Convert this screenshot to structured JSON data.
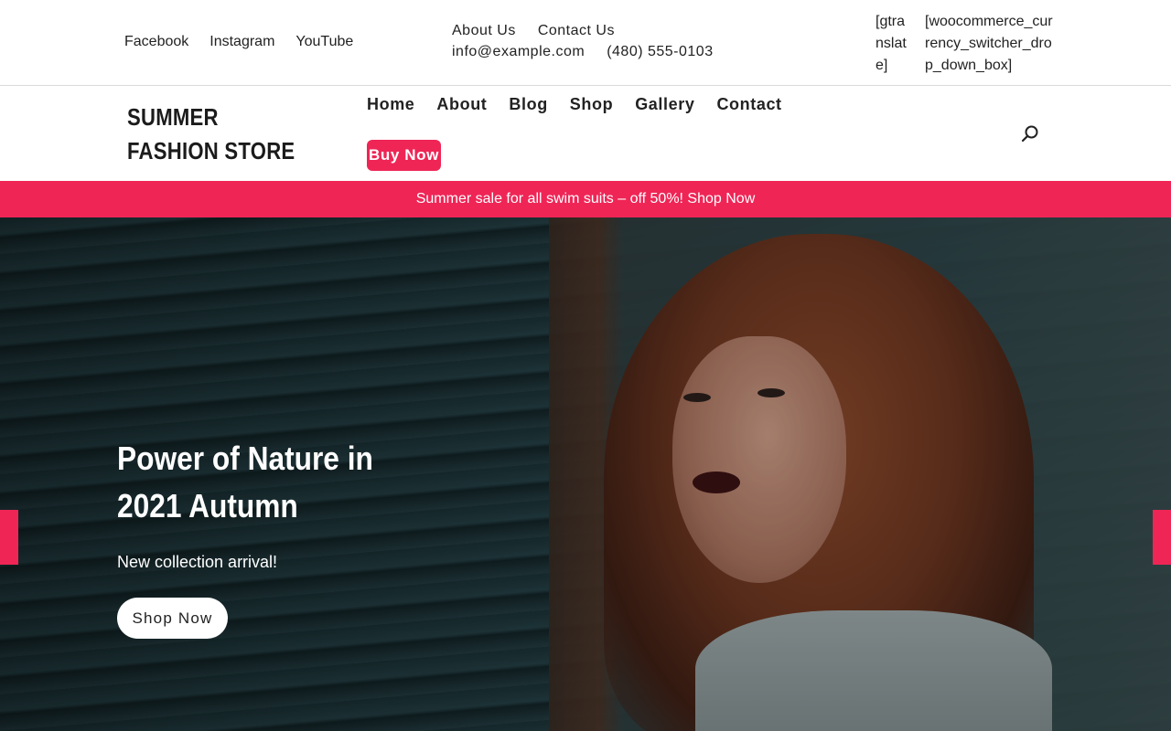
{
  "topbar": {
    "social": [
      "Facebook",
      "Instagram",
      "YouTube"
    ],
    "links": [
      "About Us",
      "Contact Us"
    ],
    "email": "info@example.com",
    "phone": "(480) 555-0103",
    "shortcode_translate": "[gtranslate]",
    "shortcode_currency": "[woocommerce_currency_switcher_drop_down_box]"
  },
  "header": {
    "logo": "SUMMER FASHION STORE",
    "nav": [
      "Home",
      "About",
      "Blog",
      "Shop",
      "Gallery",
      "Contact"
    ],
    "buy_label": "Buy Now",
    "search_icon": "search-icon"
  },
  "promo": {
    "text": "Summer sale for all swim suits – off 50%! Shop Now"
  },
  "hero": {
    "title": "Power of Nature in 2021 Autumn",
    "subtitle": "New collection arrival!",
    "button": "Shop Now"
  },
  "colors": {
    "accent": "#ef2556",
    "text": "#222222",
    "white": "#ffffff"
  }
}
